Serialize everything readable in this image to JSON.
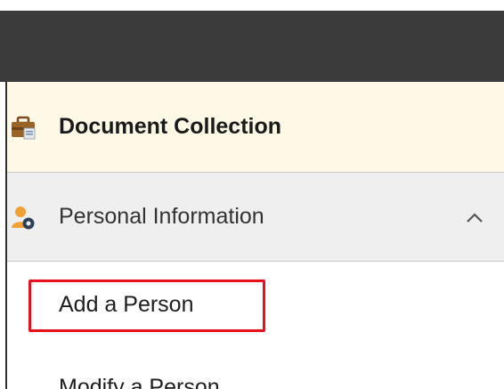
{
  "header": {
    "color": "#3b3b3b"
  },
  "menu": {
    "document_collection": {
      "label": "Document Collection",
      "icon": "briefcase-icon"
    },
    "personal_information": {
      "label": "Personal Information",
      "icon": "person-gear-icon",
      "expanded": true,
      "toggle_icon": "chevron-up-icon"
    },
    "sub_items": [
      {
        "label": "Add a Person",
        "highlighted": true
      },
      {
        "label": "Modify a Person"
      }
    ]
  },
  "colors": {
    "highlight_border": "#e8101c",
    "doc_collection_bg": "#fdf9e6",
    "personal_info_bg": "#efefef"
  }
}
